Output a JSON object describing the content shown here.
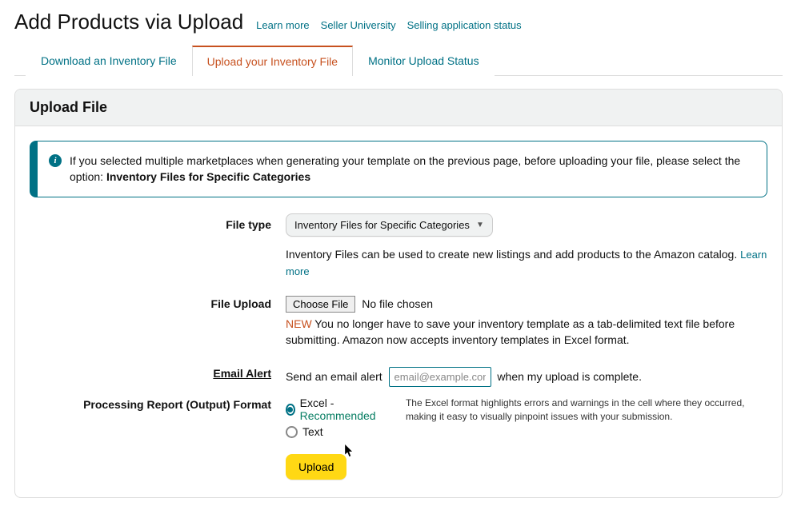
{
  "header": {
    "title": "Add Products via Upload",
    "links": [
      "Learn more",
      "Seller University",
      "Selling application status"
    ]
  },
  "tabs": [
    {
      "label": "Download an Inventory File",
      "active": false
    },
    {
      "label": "Upload your Inventory File",
      "active": true
    },
    {
      "label": "Monitor Upload Status",
      "active": false
    }
  ],
  "panel": {
    "title": "Upload File",
    "alert": {
      "prefix": "If you selected multiple marketplaces when generating your template on the previous page, before uploading your file, please select the option: ",
      "strong": "Inventory Files for Specific Categories"
    },
    "fileType": {
      "label": "File type",
      "selected": "Inventory Files for Specific Categories",
      "help": "Inventory Files can be used to create new listings and add products to the Amazon catalog. ",
      "learnMore": "Learn more"
    },
    "fileUpload": {
      "label": "File Upload",
      "chooseBtn": "Choose File",
      "status": "No file chosen",
      "newTag": "NEW",
      "note": " You no longer have to save your inventory template as a tab-delimited text file before submitting. Amazon now accepts inventory templates in Excel format."
    },
    "emailAlert": {
      "label": "Email Alert",
      "before": "Send an email alert ",
      "placeholder": "email@example.com",
      "after": " when my upload is complete."
    },
    "format": {
      "label": "Processing Report (Output) Format",
      "excelLabel": "Excel",
      "dash": " - ",
      "recommended": "Recommended",
      "textLabel": "Text",
      "note": "The Excel format highlights errors and warnings in the cell where they occurred, making it easy to visually pinpoint issues with your submission."
    },
    "uploadBtn": "Upload"
  }
}
